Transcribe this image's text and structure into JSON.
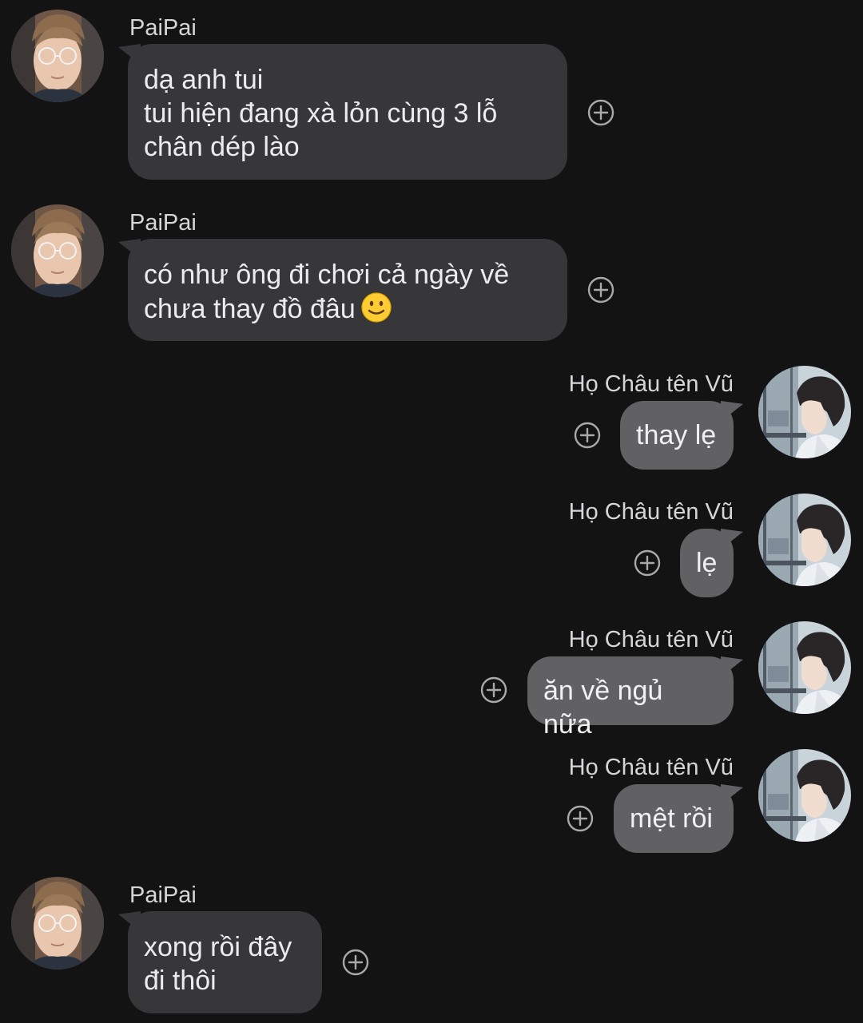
{
  "messages": [
    {
      "sender": "PaiPai",
      "text": "dạ anh tui\ntui hiện đang xà lỏn cùng 3 lỗ\nchân dép lào"
    },
    {
      "sender": "PaiPai",
      "text": "có như ông đi chơi cả ngày về\nchưa thay đồ đâu",
      "emoji": "slightly-smiling-face"
    },
    {
      "sender": "Họ Châu tên Vũ",
      "text": "thay lẹ"
    },
    {
      "sender": "Họ Châu tên Vũ",
      "text": "lẹ"
    },
    {
      "sender": "Họ Châu tên Vũ",
      "text": "ăn về ngủ nữa"
    },
    {
      "sender": "Họ Châu tên Vũ",
      "text": "mệt rồi"
    },
    {
      "sender": "PaiPai",
      "text": "xong rồi đây\nđi thôi"
    }
  ],
  "icons": {
    "add_reaction": "plus-circle-icon",
    "avatar_paipai": "paipai-avatar",
    "avatar_vu": "vu-avatar"
  },
  "colors": {
    "background": "#131314",
    "incoming_bubble": "#37373a",
    "outgoing_bubble": "#616164",
    "text": "#ececee"
  }
}
